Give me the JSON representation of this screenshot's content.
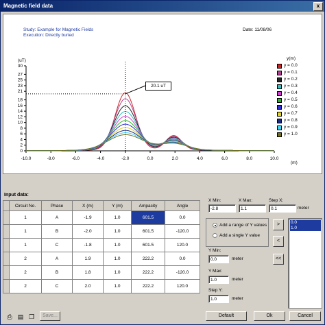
{
  "window": {
    "title": "Magnetic field data",
    "close_glyph": "x"
  },
  "chart": {
    "study": "Study: Example for Magnetic Fields",
    "execution": "Execution: Directly buried",
    "date": "Date: 11/08/06",
    "y_unit": "(uT)",
    "x_unit": "(m)",
    "callout": "20.1 uT",
    "legend_title": "y(m)"
  },
  "chart_data": {
    "type": "line",
    "xlim": [
      -10.0,
      10.0
    ],
    "ylim": [
      0,
      30
    ],
    "x_ticks": [
      "-10.0",
      "-8.0",
      "-6.0",
      "-4.0",
      "-2.0",
      "0.0",
      "2.0",
      "4.0",
      "6.0",
      "8.0",
      "10.0"
    ],
    "y_ticks": [
      "0",
      "2",
      "4",
      "6",
      "8",
      "10",
      "12",
      "14",
      "16",
      "18",
      "21",
      "23",
      "25",
      "27",
      "30"
    ],
    "peak_marker": {
      "x": -2.0,
      "y": 20.1
    },
    "series": [
      {
        "name": "y = 0.0",
        "color": "#cc2222",
        "peak1": 20.1,
        "peak2": 5.0
      },
      {
        "name": "y = 0.1",
        "color": "#b04090",
        "peak1": 18.0,
        "peak2": 4.7
      },
      {
        "name": "y = 0.2",
        "color": "#222222",
        "peak1": 15.5,
        "peak2": 4.4
      },
      {
        "name": "y = 0.3",
        "color": "#30c0c0",
        "peak1": 13.5,
        "peak2": 4.1
      },
      {
        "name": "y = 0.4",
        "color": "#d040d0",
        "peak1": 11.8,
        "peak2": 3.8
      },
      {
        "name": "y = 0.5",
        "color": "#30b030",
        "peak1": 10.3,
        "peak2": 3.5
      },
      {
        "name": "y = 0.6",
        "color": "#3030d0",
        "peak1": 9.0,
        "peak2": 3.2
      },
      {
        "name": "y = 0.7",
        "color": "#e0d020",
        "peak1": 7.8,
        "peak2": 2.9
      },
      {
        "name": "y = 0.8",
        "color": "#1a2a80",
        "peak1": 6.8,
        "peak2": 2.6
      },
      {
        "name": "y = 0.9",
        "color": "#40d0f0",
        "peak1": 6.0,
        "peak2": 2.4
      },
      {
        "name": "y = 1.0",
        "color": "#707020",
        "peak1": 5.3,
        "peak2": 2.2
      }
    ]
  },
  "input": {
    "title": "Input data:",
    "headers": [
      "Circuit No.",
      "Phase",
      "X (m)",
      "Y (m)",
      "Ampacity",
      "Angle"
    ],
    "rows": [
      [
        "1",
        "A",
        "-1.9",
        "1.0",
        "601.5",
        "0.0"
      ],
      [
        "1",
        "B",
        "-2.0",
        "1.0",
        "601.5",
        "-120.0"
      ],
      [
        "1",
        "C",
        "-1.8",
        "1.0",
        "601.5",
        "120.0"
      ],
      [
        "2",
        "A",
        "1.9",
        "1.0",
        "222.2",
        "0.0"
      ],
      [
        "2",
        "B",
        "1.8",
        "1.0",
        "222.2",
        "-120.0"
      ],
      [
        "2",
        "C",
        "2.0",
        "1.0",
        "222.2",
        "120.0"
      ]
    ]
  },
  "controls": {
    "xmin_label": "X Min:",
    "xmin": "-2.8",
    "xmax_label": "X Max:",
    "xmax": "1.1",
    "stepx_label": "Step X:",
    "stepx": "0.1",
    "meter": "meter",
    "radio_range": "Add a range of Y values",
    "radio_single": "Add a single Y value",
    "ymin_label": "Y Min:",
    "ymin": "0.0",
    "ymax_label": "Y Max:",
    "ymax": "1.0",
    "stepy_label": "Step Y:",
    "stepy": "1.0",
    "btn_right": ">",
    "btn_left": "<",
    "btn_all_left": "<<",
    "list": [
      "0.0",
      "1.0"
    ]
  },
  "footer": {
    "save": "Save...",
    "default": "Default",
    "ok": "Ok",
    "cancel": "Cancel"
  }
}
